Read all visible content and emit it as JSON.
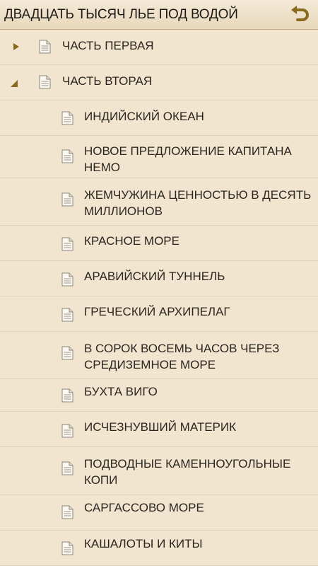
{
  "header": {
    "title": "ДВАДЦАТЬ ТЫСЯЧ ЛЬЕ ПОД ВОДОЙ",
    "back_icon": "back-arrow-icon"
  },
  "colors": {
    "background": "#f1e5cf",
    "arrow": "#8a6a1c",
    "text": "#2b2620"
  },
  "toc": [
    {
      "label": "ЧАСТЬ ПЕРВАЯ",
      "level": 0,
      "expanded": false
    },
    {
      "label": "ЧАСТЬ ВТОРАЯ",
      "level": 0,
      "expanded": true
    },
    {
      "label": "ИНДИЙСКИЙ ОКЕАН",
      "level": 1
    },
    {
      "label": "НОВОЕ ПРЕДЛОЖЕНИЕ КАПИТАНА НЕМО",
      "level": 1
    },
    {
      "label": "ЖЕМЧУЖИНА ЦЕННОСТЬЮ В ДЕСЯТЬ МИЛЛИОНОВ",
      "level": 1
    },
    {
      "label": "КРАСНОЕ МОРЕ",
      "level": 1
    },
    {
      "label": "АРАВИЙСКИЙ ТУННЕЛЬ",
      "level": 1
    },
    {
      "label": "ГРЕЧЕСКИЙ АРХИПЕЛАГ",
      "level": 1
    },
    {
      "label": "В СОРОК ВОСЕМЬ ЧАСОВ ЧЕРЕЗ СРЕДИЗЕМНОЕ МОРЕ",
      "level": 1
    },
    {
      "label": "БУХТА ВИГО",
      "level": 1
    },
    {
      "label": "ИСЧЕЗНУВШИЙ МАТЕРИК",
      "level": 1
    },
    {
      "label": "ПОДВОДНЫЕ КАМЕННОУГОЛЬНЫЕ КОПИ",
      "level": 1
    },
    {
      "label": "САРГАССОВО МОРЕ",
      "level": 1
    },
    {
      "label": "КАШАЛОТЫ И КИТЫ",
      "level": 1
    }
  ]
}
